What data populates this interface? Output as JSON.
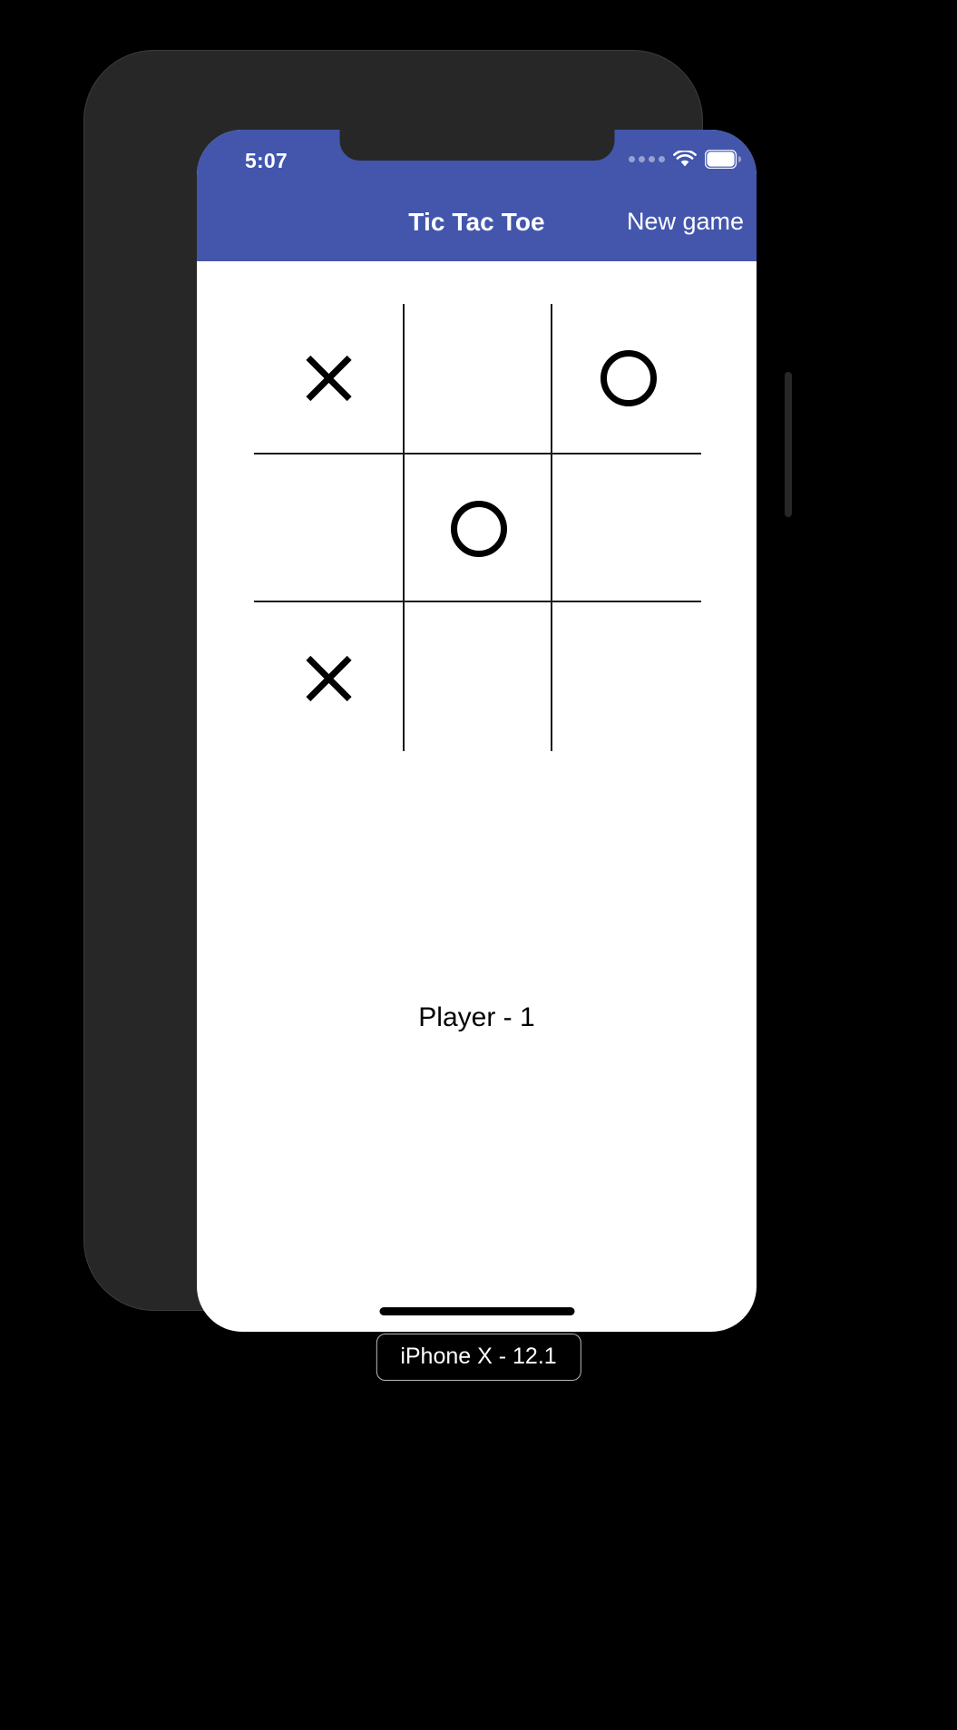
{
  "device": {
    "label": "iPhone X - 12.1",
    "model": "iPhone X"
  },
  "status_bar": {
    "time": "5:07",
    "signal_icon": "signal-dots-icon",
    "wifi_icon": "wifi-icon",
    "battery_icon": "battery-full-icon",
    "background_color": "#4356ac",
    "text_color": "#ffffff"
  },
  "nav_bar": {
    "title": "Tic Tac Toe",
    "new_game_label": "New game",
    "background_color": "#4356ac"
  },
  "board": {
    "rows": [
      [
        {
          "name": "cell-0-0",
          "mark": "X"
        },
        {
          "name": "cell-0-1",
          "mark": ""
        },
        {
          "name": "cell-0-2",
          "mark": "O"
        }
      ],
      [
        {
          "name": "cell-1-0",
          "mark": ""
        },
        {
          "name": "cell-1-1",
          "mark": "O"
        },
        {
          "name": "cell-1-2",
          "mark": ""
        }
      ],
      [
        {
          "name": "cell-2-0",
          "mark": "X"
        },
        {
          "name": "cell-2-1",
          "mark": ""
        },
        {
          "name": "cell-2-2",
          "mark": ""
        }
      ]
    ],
    "line_color": "#1a1a1a",
    "mark_color": "#000000"
  },
  "game_status": {
    "text": "Player - 1"
  }
}
